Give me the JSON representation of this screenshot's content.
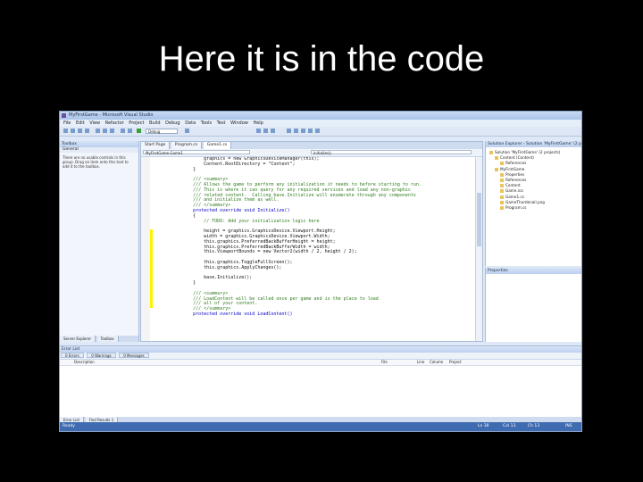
{
  "slide": {
    "title": "Here it is in the code"
  },
  "window": {
    "title": "MyFirstGame - Microsoft Visual Studio"
  },
  "menu": [
    "File",
    "Edit",
    "View",
    "Refactor",
    "Project",
    "Build",
    "Debug",
    "Data",
    "Tools",
    "Test",
    "Window",
    "Help"
  ],
  "toolbar": {
    "config": "Debug"
  },
  "toolbox": {
    "title": "Toolbox",
    "group": "General",
    "empty_message": "There are no usable controls in this group. Drag an item onto this text to add it to the toolbox.",
    "tabs": [
      "Server Explorer",
      "Toolbox"
    ]
  },
  "editor": {
    "tabs": [
      "Start Page",
      "Program.cs",
      "Game1.cs"
    ],
    "nav_left": "MyFirstGame.Game1",
    "nav_right": "Initialize()",
    "lines": [
      "            graphics = new GraphicsDeviceManager(this);",
      "            Content.RootDirectory = \"Content\";",
      "        }",
      "",
      "        /// <summary>",
      "        /// Allows the game to perform any initialization it needs to before starting to run.",
      "        /// This is where it can query for any required services and load any non-graphic",
      "        /// related content.  Calling base.Initialize will enumerate through any components",
      "        /// and initialize them as well.",
      "        /// </summary>",
      "        protected override void Initialize()",
      "        {",
      "            // TODO: Add your initialization logic here",
      "",
      "            height = graphics.GraphicsDevice.Viewport.Height;",
      "            width = graphics.GraphicsDevice.Viewport.Width;",
      "            this.graphics.PreferredBackBufferHeight = height;",
      "            this.graphics.PreferredBackBufferWidth = width;",
      "            this.ViewportBounds = new Vector2(width / 2, height / 2);",
      "",
      "            this.graphics.ToggleFullScreen();",
      "            this.graphics.ApplyChanges();",
      "",
      "            base.Initialize();",
      "        }",
      "",
      "        /// <summary>",
      "        /// LoadContent will be called once per game and is the place to load",
      "        /// all of your content.",
      "        /// </summary>",
      "        protected override void LoadContent()"
    ]
  },
  "solution_explorer": {
    "title": "Solution Explorer - Solution 'MyFirstGame' (2 projects)",
    "items": [
      "Solution 'MyFirstGame' (2 projects)",
      "Content (Content)",
      "References",
      "MyFirstGame",
      "Properties",
      "References",
      "Content",
      "Game.ico",
      "Game1.cs",
      "GameThumbnail.png",
      "Program.cs"
    ]
  },
  "properties": {
    "title": "Properties"
  },
  "error_list": {
    "title": "Error List",
    "filters": [
      "0 Errors",
      "0 Warnings",
      "0 Messages"
    ],
    "columns": [
      "Description",
      "File",
      "Line",
      "Column",
      "Project"
    ],
    "tabs": [
      "Error List",
      "Find Results 1"
    ]
  },
  "status": {
    "left": "Ready",
    "ln": "Ln 38",
    "col": "Col 13",
    "ch": "Ch 13",
    "mode": "INS"
  }
}
